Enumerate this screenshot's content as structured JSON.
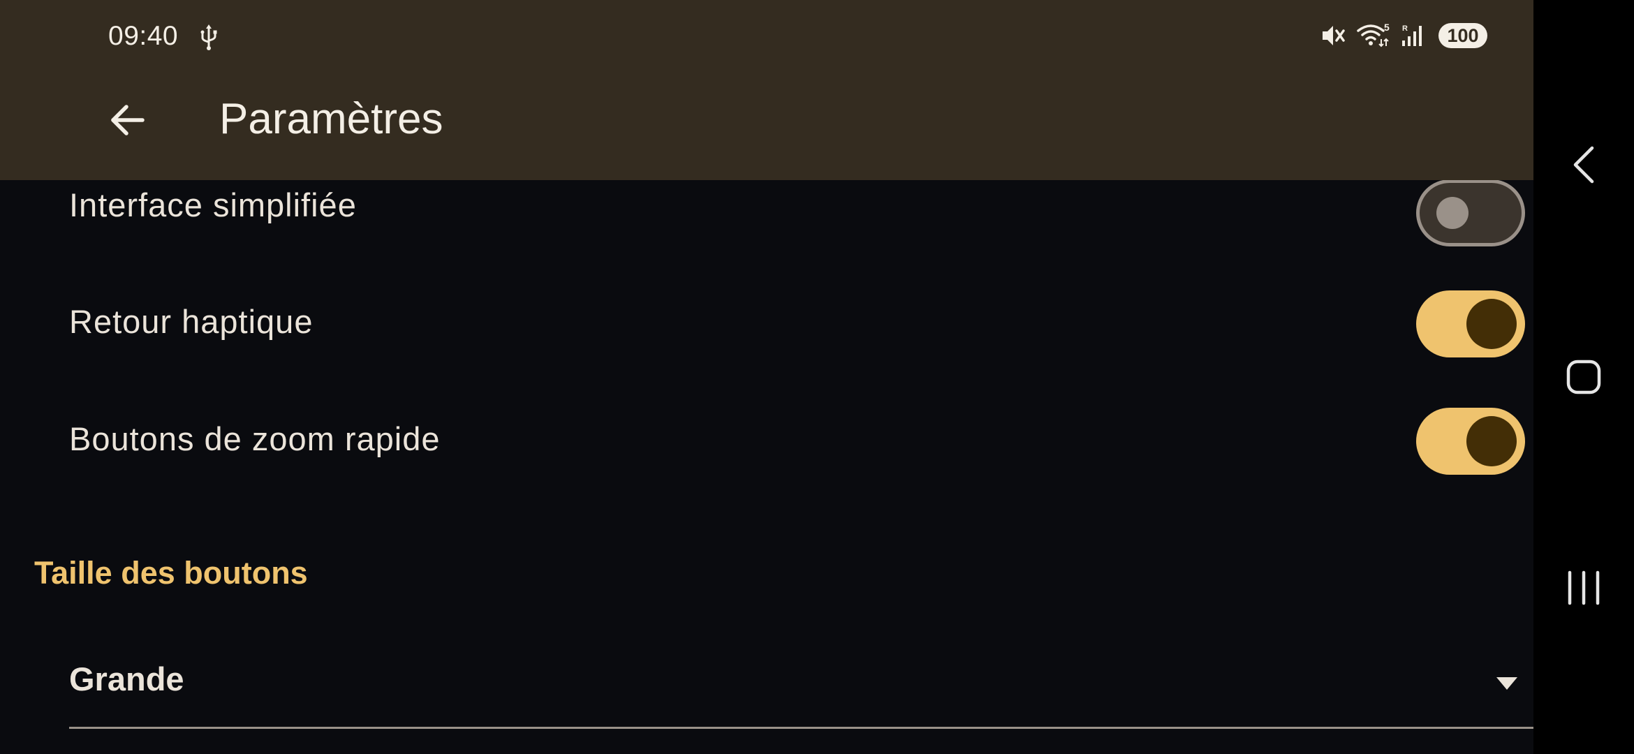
{
  "status_bar": {
    "time": "09:40",
    "battery": "100",
    "wifi_badge": "5"
  },
  "header": {
    "title": "Paramètres"
  },
  "settings": [
    {
      "label": "Interface simplifiée",
      "enabled": false
    },
    {
      "label": "Retour haptique",
      "enabled": true
    },
    {
      "label": "Boutons de zoom rapide",
      "enabled": true
    }
  ],
  "button_size_section": {
    "title": "Taille des boutons",
    "selected_value": "Grande"
  },
  "icons": {
    "back": "arrow-left-icon",
    "usb": "usb-icon",
    "mute": "mute-icon",
    "wifi": "wifi-icon",
    "signal": "signal-icon",
    "caret": "caret-down-icon",
    "nav_back": "chevron-left-icon",
    "nav_home": "home-square-icon",
    "nav_recents": "recents-lines-icon"
  },
  "colors": {
    "header_bg": "#342c20",
    "app_bg": "#0a0b0f",
    "accent": "#efc36e",
    "toggle_knob_on": "#432e06",
    "text": "#ebe4da"
  }
}
